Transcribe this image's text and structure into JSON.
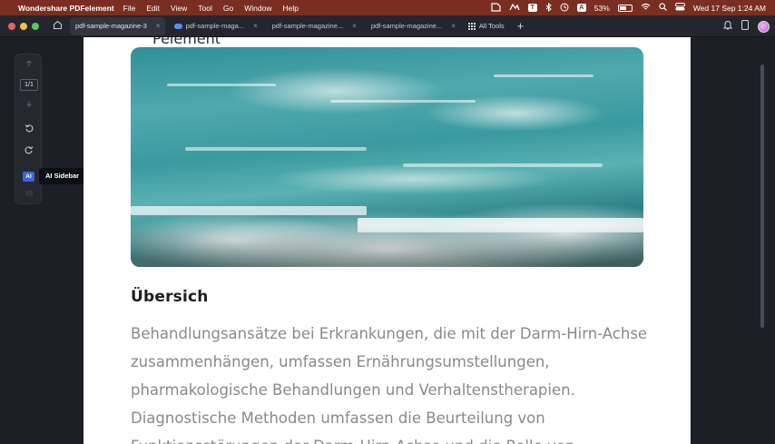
{
  "menubar": {
    "app_name": "Wondershare PDFelement",
    "items": [
      "File",
      "Edit",
      "View",
      "Tool",
      "Go",
      "Window",
      "Help"
    ],
    "battery": "53%",
    "datetime": "Wed 17 Sep  1:24 AM",
    "status_icons": [
      "pdfelement-icon",
      "cloud-sync-icon",
      "text-icon",
      "bluetooth-icon",
      "timer-icon",
      "keyboard-input-icon",
      "battery-icon",
      "wifi-icon",
      "search-icon",
      "control-center-icon",
      "siri-icon"
    ],
    "input_badge": "A",
    "text_badge": "T"
  },
  "tabs": {
    "items": [
      {
        "label": "pdf-sample-magazine-3",
        "active": true,
        "cloud": false
      },
      {
        "label": "pdf-sample-maga...",
        "active": false,
        "cloud": true
      },
      {
        "label": "pdf-sample-magazine...",
        "active": false,
        "cloud": false
      },
      {
        "label": "pdf-sample-magazine...",
        "active": false,
        "cloud": false
      }
    ],
    "all_tools": "All Tools",
    "close_glyph": "×",
    "new_tab_glyph": "+"
  },
  "sidebar": {
    "page_indicator": "1/1",
    "ai_label": "AI",
    "tooltip": "AI Sidebar"
  },
  "document": {
    "top_heading": "Pelement",
    "section_title": "Übersich",
    "body_lines": [
      "Behandlungsansätze bei Erkrankungen, die mit der Darm-Hirn-Achse",
      "zusammenhängen, umfassen Ernährungsumstellungen,",
      "pharmakologische Behandlungen und Verhaltenstherapien.",
      "Diagnostische Methoden umfassen die Beurteilung von",
      "Funktionsstörungen der Darm-Hirn-Achse und die Rolle von"
    ]
  },
  "colors": {
    "menubar": "#7a2e22",
    "tabbar": "#24262e",
    "workspace": "#1d1f26",
    "accent": "#3f63d8",
    "traffic_close": "#ee5f57",
    "traffic_min": "#f4bd4f",
    "traffic_max": "#5ac75c"
  }
}
